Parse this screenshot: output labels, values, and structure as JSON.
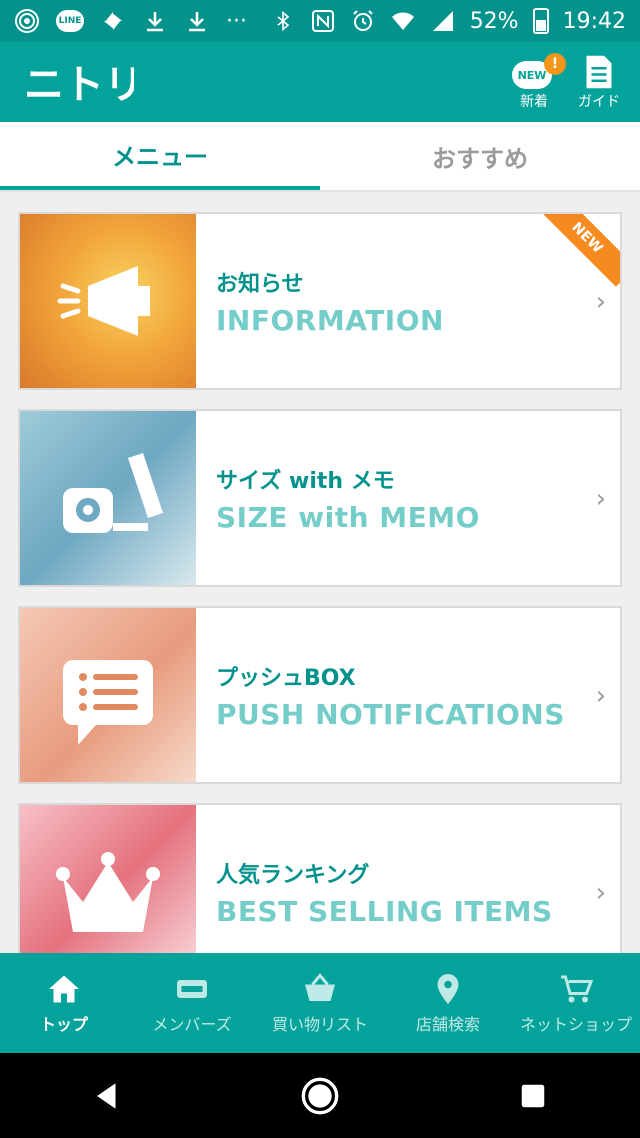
{
  "status_bar": {
    "battery": "52%",
    "time": "19:42",
    "ellipsis": "···",
    "line_label": "LINE"
  },
  "header": {
    "logo_text": "ニトリ",
    "new_badge": "NEW",
    "new_alert": "!",
    "new_label": "新着",
    "guide_label": "ガイド"
  },
  "tabs": [
    {
      "label": "メニュー"
    },
    {
      "label": "おすすめ"
    }
  ],
  "cards": [
    {
      "jp": "お知らせ",
      "en": "INFORMATION",
      "icon": "megaphone-icon",
      "badge": "NEW"
    },
    {
      "jp": "サイズ with メモ",
      "en": "SIZE with MEMO",
      "icon": "tape-measure-icon"
    },
    {
      "jp": "プッシュBOX",
      "en": "PUSH NOTIFICATIONS",
      "icon": "chat-list-icon"
    },
    {
      "jp": "人気ランキング",
      "en": "BEST SELLING ITEMS",
      "icon": "crown-icon"
    }
  ],
  "bottom_nav": [
    {
      "label": "トップ",
      "icon": "home-icon"
    },
    {
      "label": "メンバーズ",
      "icon": "member-card-icon"
    },
    {
      "label": "買い物リスト",
      "icon": "basket-icon"
    },
    {
      "label": "店舗検索",
      "icon": "location-pin-icon"
    },
    {
      "label": "ネットショップ",
      "icon": "cart-icon"
    }
  ],
  "colors": {
    "brand": "#03a39b",
    "status": "#03928c",
    "accent": "#f58b20"
  }
}
